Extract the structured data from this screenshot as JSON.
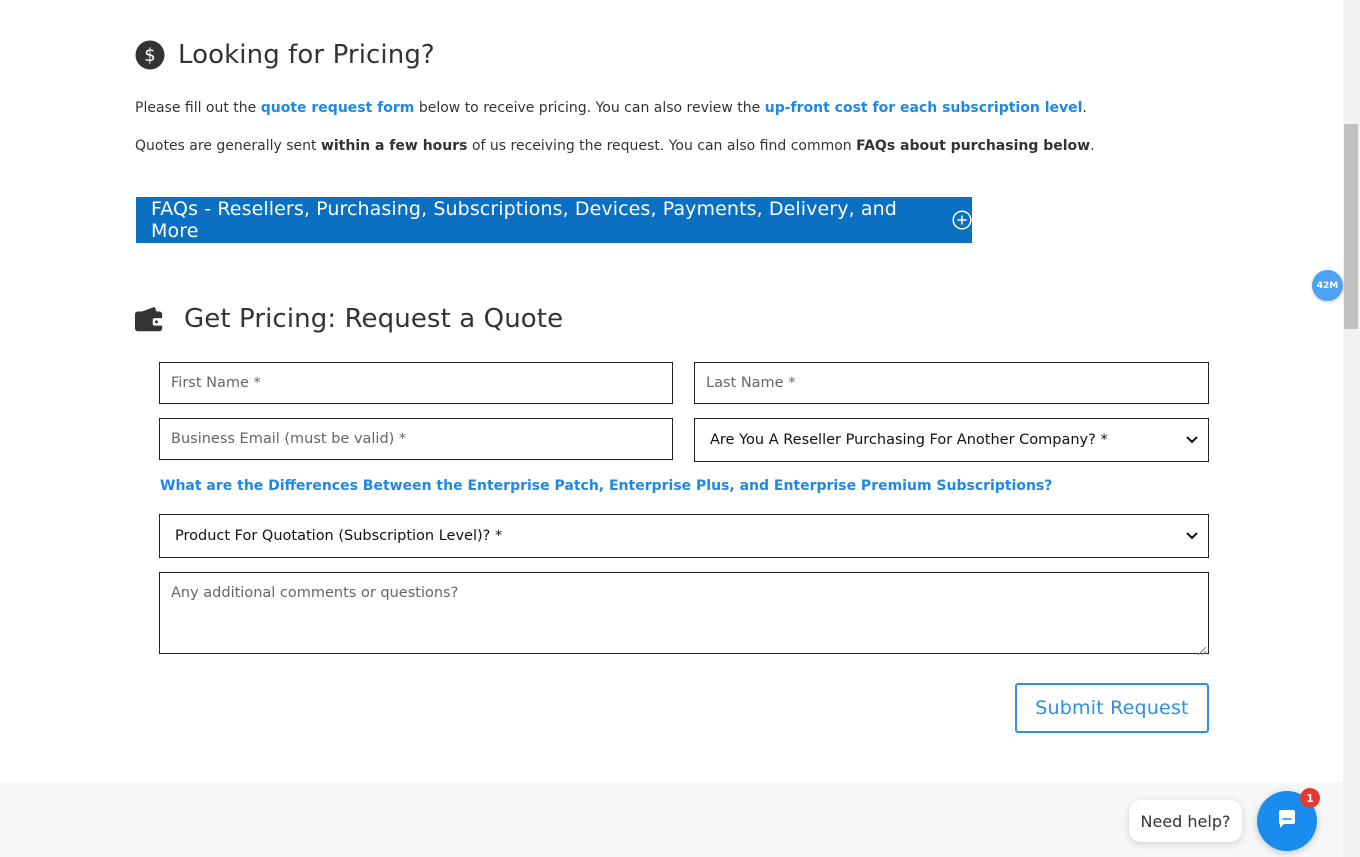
{
  "pricing_section": {
    "title": "Looking for Pricing?",
    "p1_pre": "Please fill out the ",
    "p1_link1": "quote request form",
    "p1_mid": " below to receive pricing. You can also review the ",
    "p1_link2": "up-front cost for each subscription level",
    "p1_end": ".",
    "p2_pre": "Quotes are generally sent ",
    "p2_bold1": "within a few hours",
    "p2_mid": " of us receiving the request. You can also find common ",
    "p2_bold2": "FAQs about purchasing below",
    "p2_end": "."
  },
  "faq_bar": {
    "label": "FAQs - Resellers, Purchasing, Subscriptions, Devices, Payments, Delivery, and More",
    "icon": "plus-circle-icon"
  },
  "quote_section": {
    "title": "Get Pricing: Request a Quote",
    "icon": "wallet-icon"
  },
  "form": {
    "first_name_placeholder": "First Name *",
    "last_name_placeholder": "Last Name *",
    "email_placeholder": "Business Email (must be valid) *",
    "reseller_selected": "Are You A Reseller Purchasing For Another Company? *",
    "differences_link": "What are the Differences Between the Enterprise Patch, Enterprise Plus, and Enterprise Premium Subscriptions?",
    "product_selected": "Product For Quotation (Subscription Level)? *",
    "comments_placeholder": "Any additional comments or questions?",
    "submit_label": "Submit Request"
  },
  "widgets": {
    "badge_label": "42M",
    "help_label": "Need help?",
    "chat_unread_count": "1"
  },
  "colors": {
    "accent": "#1e88e5",
    "faq_bar_bg": "#0b6fc2",
    "chat_button": "#1a8cf0",
    "notification": "#e53935"
  }
}
